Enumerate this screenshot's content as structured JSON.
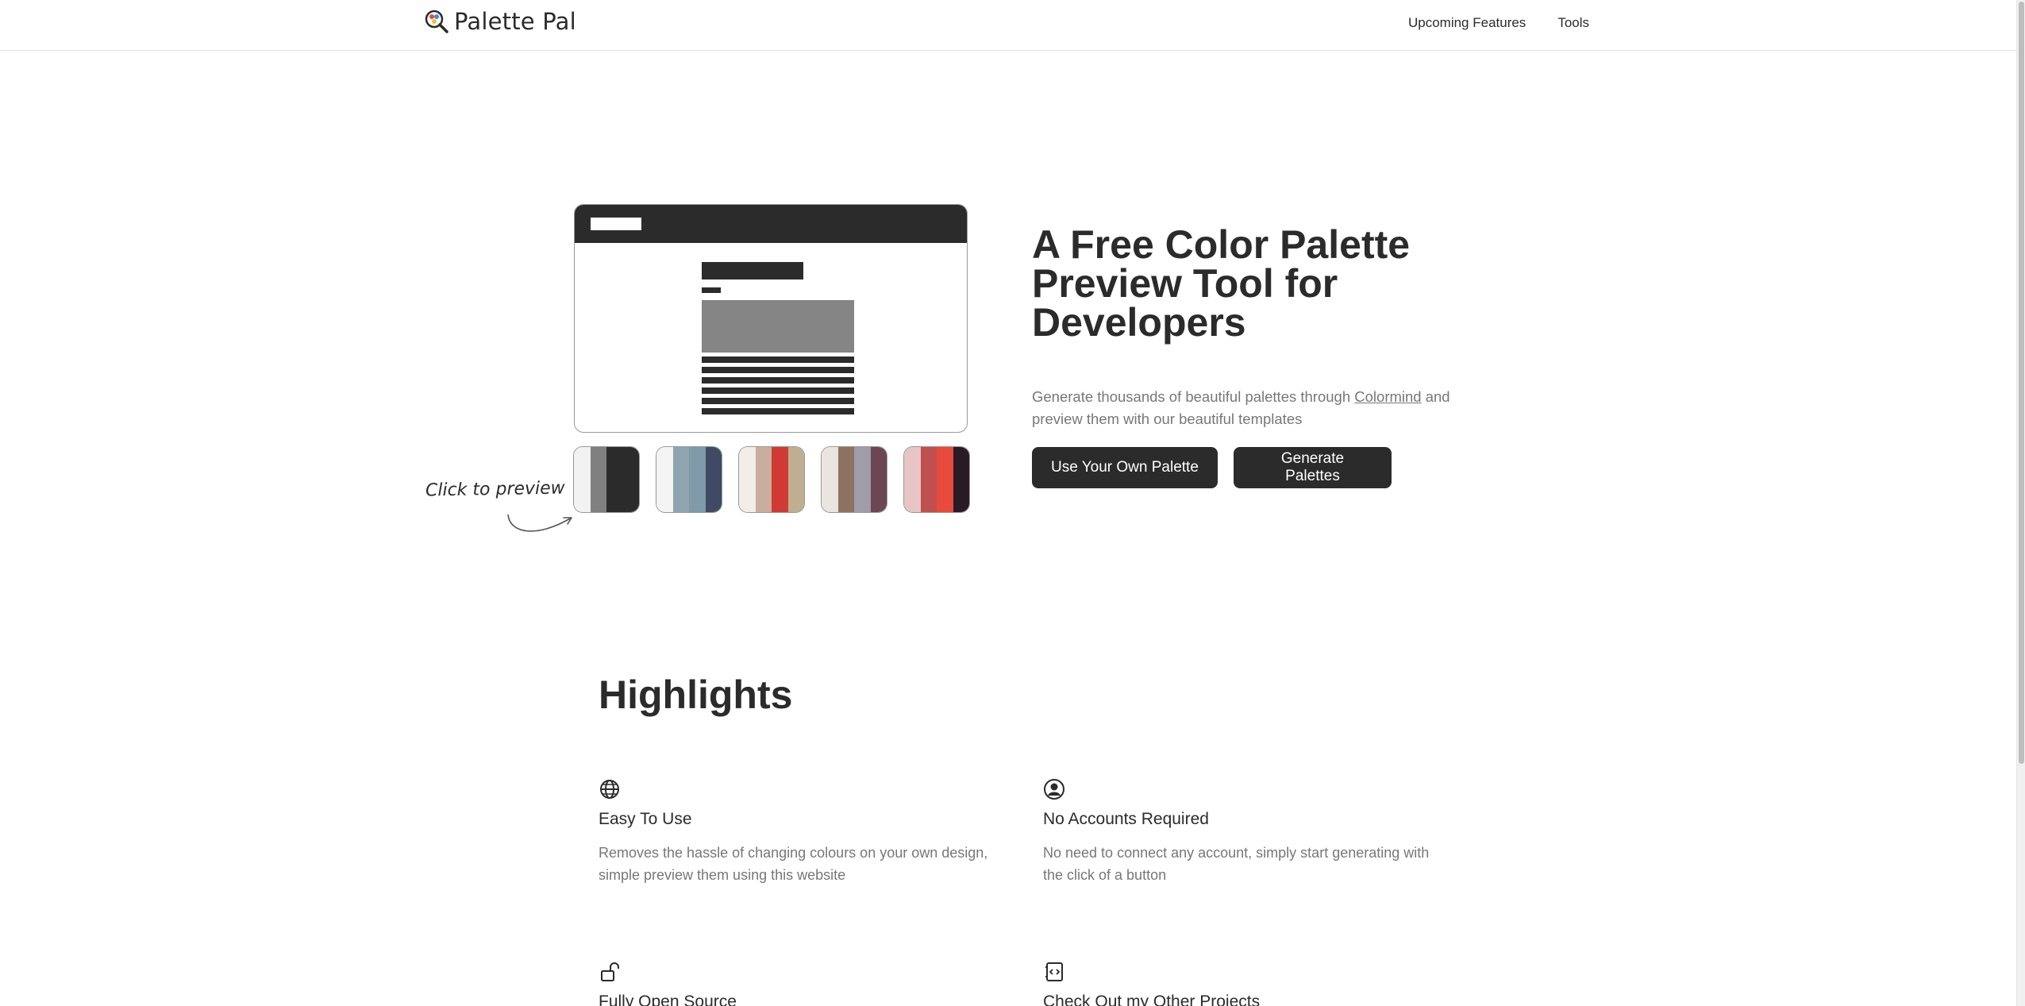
{
  "navbar": {
    "brand": "Palette Pal",
    "links": [
      "Upcoming Features",
      "Tools"
    ]
  },
  "preview": {
    "click_note": "Click to preview",
    "swatches": [
      [
        "#f2f2f2",
        "#808080",
        "#2b2b2b",
        "#2b2b2b"
      ],
      [
        "#f4f4f4",
        "#8ea4b0",
        "#7f9aa8",
        "#3f4a64"
      ],
      [
        "#f3ede8",
        "#c9aea0",
        "#d03a34",
        "#bfae90"
      ],
      [
        "#ebe5e0",
        "#8d7262",
        "#a09ca8",
        "#6c4652"
      ],
      [
        "#e8c4c4",
        "#c04f4f",
        "#e84a3c",
        "#2a1a26"
      ]
    ]
  },
  "hero": {
    "title": "A Free Color Palette Preview Tool for Developers",
    "desc_before": "Generate thousands of beautiful palettes through ",
    "desc_link": "Colormind",
    "desc_after": " and preview them with our beautiful templates",
    "btn_own": "Use Your Own Palette",
    "btn_generate": "Generate Palettes"
  },
  "highlights": {
    "title": "Highlights",
    "items": [
      {
        "icon": "globe-icon",
        "title": "Easy To Use",
        "desc": "Removes the hassle of changing colours on your own design, simple preview them using this website"
      },
      {
        "icon": "user-circle-icon",
        "title": "No Accounts Required",
        "desc": "No need to connect any account, simply start generating with the click of a button"
      },
      {
        "icon": "unlock-icon",
        "title": "Fully Open Source",
        "desc": ""
      },
      {
        "icon": "code-file-icon",
        "title": "Check Out my Other Projects",
        "desc": ""
      }
    ]
  },
  "colors": {
    "dark": "#2b2b2b",
    "muted": "#777777"
  }
}
